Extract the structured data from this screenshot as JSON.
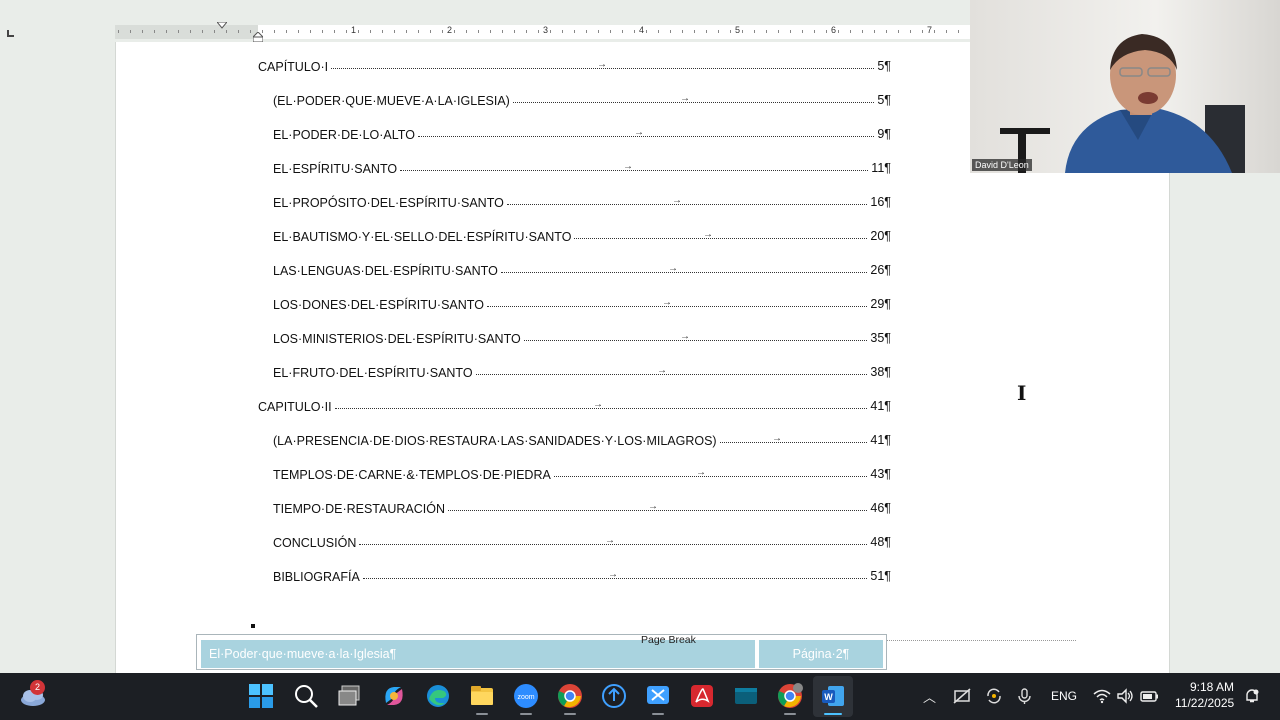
{
  "ruler": {
    "numbers": [
      "1",
      "2",
      "3",
      "4",
      "5",
      "6",
      "7"
    ]
  },
  "toc": [
    {
      "text": "CAPÍTULO·I",
      "page": "5¶",
      "indent": 0
    },
    {
      "text": "(EL·PODER·QUE·MUEVE·A·LA·IGLESIA)",
      "page": "5¶",
      "indent": 1
    },
    {
      "text": "EL·PODER·DE·LO·ALTO",
      "page": "9¶",
      "indent": 1
    },
    {
      "text": "EL·ESPÍRITU·SANTO",
      "page": "11¶",
      "indent": 1
    },
    {
      "text": "EL·PROPÓSITO·DEL·ESPÍRITU·SANTO",
      "page": "16¶",
      "indent": 1
    },
    {
      "text": "EL·BAUTISMO·Y·EL·SELLO·DEL·ESPÍRITU·SANTO",
      "page": "20¶",
      "indent": 1
    },
    {
      "text": "LAS·LENGUAS·DEL·ESPÍRITU·SANTO",
      "page": "26¶",
      "indent": 1
    },
    {
      "text": "LOS·DONES·DEL·ESPÍRITU·SANTO",
      "page": "29¶",
      "indent": 1
    },
    {
      "text": "LOS·MINISTERIOS·DEL·ESPÍRITU·SANTO",
      "page": "35¶",
      "indent": 1
    },
    {
      "text": "EL·FRUTO·DEL·ESPÍRITU·SANTO",
      "page": "38¶",
      "indent": 1
    },
    {
      "text": "CAPITULO·II",
      "page": "41¶",
      "indent": 0
    },
    {
      "text": "(LA·PRESENCIA·DE·DIOS·RESTAURA·LAS·SANIDADES·Y·LOS·MILAGROS)",
      "page": "41¶",
      "indent": 1
    },
    {
      "text": "TEMPLOS·DE·CARNE·&·TEMPLOS·DE·PIEDRA",
      "page": "43¶",
      "indent": 1
    },
    {
      "text": "TIEMPO·DE·RESTAURACIÓN",
      "page": "46¶",
      "indent": 1
    },
    {
      "text": "CONCLUSIÓN",
      "page": "48¶",
      "indent": 1
    },
    {
      "text": "BIBLIOGRAFÍA",
      "page": "51¶",
      "indent": 1
    }
  ],
  "tab_arrow": "→",
  "page_break_label": "Page Break",
  "footer": {
    "title": "El·Poder·que·mueve·a·la·Iglesia¶",
    "page": "Página·2¶"
  },
  "video": {
    "participant_name": "David D'Leon"
  },
  "taskbar": {
    "weather_badge": "2",
    "language": "ENG",
    "time": "9:18 AM",
    "date": "11/22/2025",
    "apps": [
      "start",
      "search",
      "task-view",
      "copilot",
      "edge",
      "file-explorer",
      "zoom",
      "chrome",
      "remote-desktop",
      "snipping-tool",
      "acrobat",
      "terminal",
      "chrome-profile",
      "word"
    ]
  },
  "colors": {
    "footer_fill": "#a9d3df",
    "taskbar": "#1c1f24",
    "page": "#ffffff"
  }
}
